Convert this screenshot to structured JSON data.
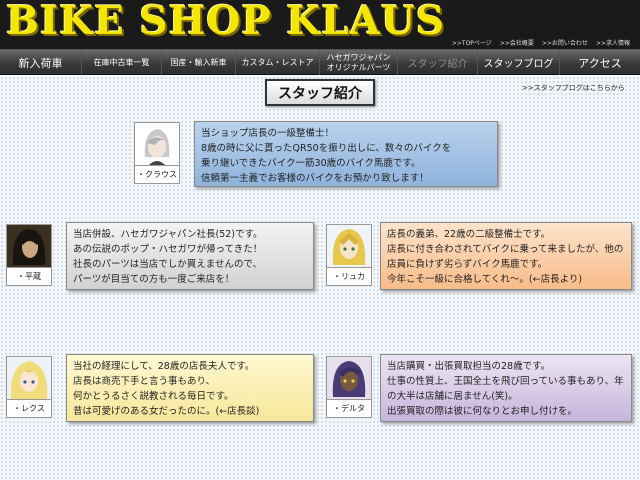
{
  "header": {
    "site_title": "BIKE SHOP KLAUS",
    "top_links": [
      ">>TOPページ",
      ">>会社概要",
      ">>お問い合わせ",
      ">>求人情報"
    ]
  },
  "nav": {
    "items": [
      {
        "label": "新入荷車"
      },
      {
        "label": "在庫中古車一覧"
      },
      {
        "label": "国産・輸入新車"
      },
      {
        "label": "カスタム・レストア"
      },
      {
        "label_line1": "ハセガワジャパン",
        "label_line2": "オリジナルパーツ"
      },
      {
        "label": "スタッフ紹介",
        "active": true
      },
      {
        "label": "スタッフブログ"
      },
      {
        "label": "アクセス"
      }
    ]
  },
  "page": {
    "title": "スタッフ紹介",
    "blog_link": ">>スタッフブログはこちらから"
  },
  "staff": [
    {
      "name": "・クラウス",
      "color": "#a9c6e8",
      "lines": [
        "当ショップ店長の一級整備士！",
        "8歳の時に父に貰ったQR50を振り出しに、数々のバイクを",
        "乗り継いできたバイク一筋30歳のバイク馬鹿です。",
        "信頼第一主義でお客様のバイクをお預かり致します！"
      ]
    },
    {
      "name": "・平蔵",
      "color": "#e4e4e4",
      "lines": [
        "当店併設、ハセガワジャパン社長(52)です。",
        "あの伝説のポップ・ハセガワが帰ってきた！",
        "社長のパーツは当店でしか買えませんので、",
        "パーツが目当ての方も一度ご来店を！"
      ]
    },
    {
      "name": "・リュカ",
      "color": "#fbd0ac",
      "lines": [
        "店長の義弟、22歳の二級整備士です。",
        "店長に付き合わされてバイクに乗って来ましたが、他の店員に負けず劣らずバイク馬鹿です。",
        "今年こそ一級に合格してくれ〜。(←店長より)"
      ]
    },
    {
      "name": "・レクス",
      "color": "#fbefb8",
      "lines": [
        "当社の経理にして、28歳の店長夫人です。",
        "店長は商売下手と言う事もあり、",
        "何かとうるさく説教される毎日です。",
        "昔は可愛げのある女だったのに。(←店長談)"
      ]
    },
    {
      "name": "・デルタ",
      "color": "#d9cdea",
      "lines": [
        "当店購買・出張買取担当の28歳です。",
        "仕事の性質上、王国全土を飛び回っている事もあり、年の大半は店舗に居ません(笑)。",
        "出張買取の際は彼に何なりとお申し付けを。"
      ]
    }
  ]
}
